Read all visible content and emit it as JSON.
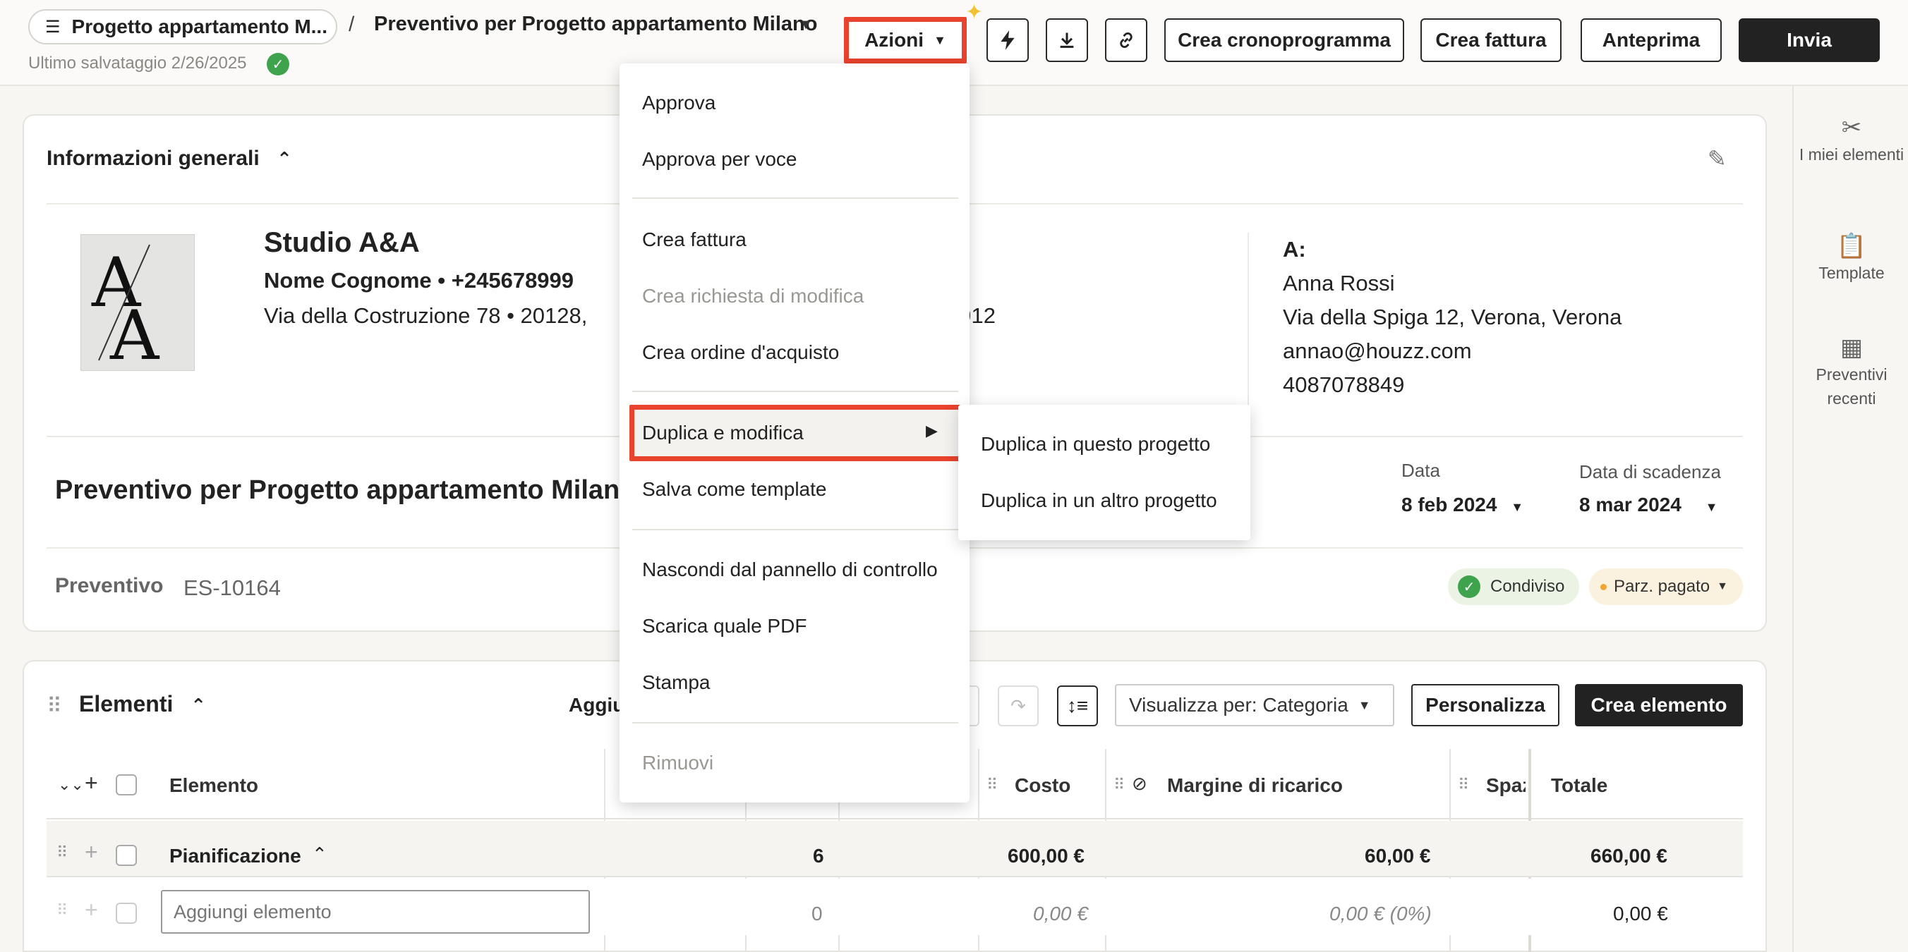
{
  "header": {
    "project_name": "Progetto appartamento M...",
    "breadcrumb_sep": "/",
    "doc_title": "Preventivo per Progetto appartamento Milano",
    "last_saved": "Ultimo salvataggio 2/26/2025",
    "buttons": {
      "actions": "Azioni",
      "schedule": "Crea cronoprogramma",
      "invoice": "Crea fattura",
      "preview": "Anteprima",
      "send": "Invia"
    }
  },
  "actions_menu": {
    "items": [
      {
        "label": "Approva",
        "enabled": true
      },
      {
        "label": "Approva per voce",
        "enabled": true
      },
      {
        "label": "Crea fattura",
        "enabled": true
      },
      {
        "label": "Crea richiesta di modifica",
        "enabled": false
      },
      {
        "label": "Crea ordine d'acquisto",
        "enabled": true
      },
      {
        "label": "Duplica e modifica",
        "enabled": true,
        "highlighted": true
      },
      {
        "label": "Salva come template",
        "enabled": true
      },
      {
        "label": "Nascondi dal pannello di controllo",
        "enabled": true
      },
      {
        "label": "Scarica quale PDF",
        "enabled": true
      },
      {
        "label": "Stampa",
        "enabled": true
      },
      {
        "label": "Rimuovi",
        "enabled": false
      }
    ],
    "submenu": [
      {
        "label": "Duplica in questo progetto"
      },
      {
        "label": "Duplica in un altro progetto"
      }
    ]
  },
  "right_rail": {
    "items": [
      {
        "label": "I miei elementi",
        "icon": "tools-icon"
      },
      {
        "label": "Template",
        "icon": "clipboard-icon"
      },
      {
        "label": "Preventivi recenti",
        "icon": "calculator-icon"
      }
    ]
  },
  "general_info": {
    "title": "Informazioni generali",
    "company": {
      "name": "Studio A&A",
      "contact": "Nome Cognome  •  +245678999",
      "address": "Via della Costruzione 78  •  20128,",
      "address_tail": "8912"
    },
    "client": {
      "label": "A:",
      "name": "Anna Rossi",
      "address": "Via della Spiga 12, Verona, Verona",
      "email": "annao@houzz.com",
      "phone": "4087078849"
    },
    "quote_title": "Preventivo per Progetto appartamento Milan",
    "date_label": "Data",
    "date_value": "8 feb 2024",
    "due_label": "Data di scadenza",
    "due_value": "8 mar 2024",
    "quote_label": "Preventivo",
    "quote_number": "ES-10164",
    "status_shared": "Condiviso",
    "status_paid": "Parz. pagato"
  },
  "elements": {
    "title": "Elementi",
    "add_partial": "Aggiu",
    "view_by": "Visualizza per: Categoria",
    "customize": "Personalizza",
    "create": "Crea elemento",
    "columns": {
      "element": "Elemento",
      "cost": "Costo",
      "markup": "Margine di ricarico",
      "space": "Spaz",
      "total": "Totale"
    },
    "rows": [
      {
        "name": "Pianificazione",
        "qty": "6",
        "cost": "600,00 €",
        "markup": "60,00 €",
        "total": "660,00 €"
      },
      {
        "placeholder": "Aggiungi elemento",
        "qty": "0",
        "cost": "0,00 €",
        "markup": "0,00 € (0%)",
        "total": "0,00 €"
      }
    ]
  },
  "colors": {
    "highlight": "#e8432d",
    "success": "#3fa34d",
    "primary_dark": "#222222"
  }
}
